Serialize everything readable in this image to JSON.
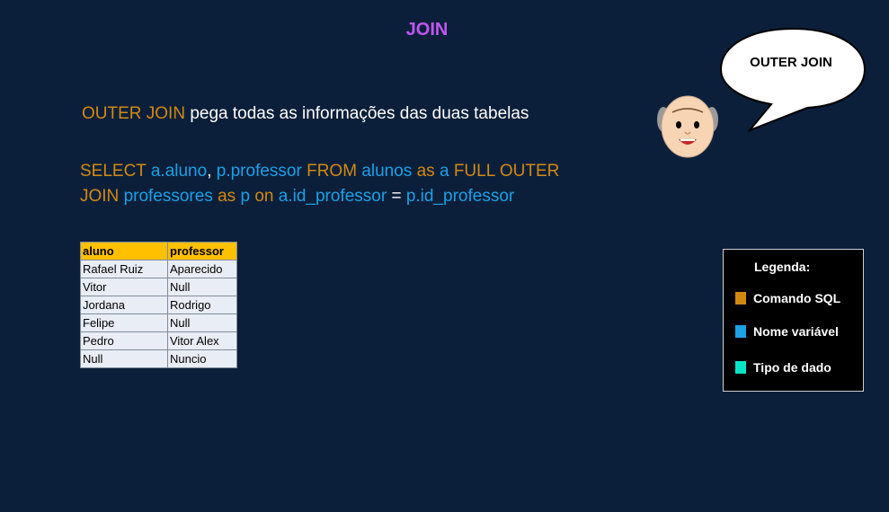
{
  "title": "JOIN",
  "description": {
    "keyword": "OUTER JOIN",
    "rest": " pega todas as informações das duas tabelas"
  },
  "sql": [
    {
      "text": "SELECT ",
      "type": "kw"
    },
    {
      "text": "a.aluno",
      "type": "var"
    },
    {
      "text": ", ",
      "type": "wh"
    },
    {
      "text": "p.professor ",
      "type": "var"
    },
    {
      "text": "FROM ",
      "type": "kw"
    },
    {
      "text": "alunos ",
      "type": "var"
    },
    {
      "text": "as ",
      "type": "kw"
    },
    {
      "text": "a ",
      "type": "var"
    },
    {
      "text": "FULL OUTER JOIN ",
      "type": "kw"
    },
    {
      "text": "professores ",
      "type": "var"
    },
    {
      "text": "as ",
      "type": "kw"
    },
    {
      "text": "p ",
      "type": "var"
    },
    {
      "text": "on ",
      "type": "kw"
    },
    {
      "text": "a.id_professor ",
      "type": "var"
    },
    {
      "text": "= ",
      "type": "wh"
    },
    {
      "text": "p.id_professor",
      "type": "var"
    }
  ],
  "table": {
    "headers": [
      "aluno",
      "professor"
    ],
    "rows": [
      [
        "Rafael Ruiz",
        "Aparecido"
      ],
      [
        "Vitor",
        "Null"
      ],
      [
        "Jordana",
        "Rodrigo"
      ],
      [
        "Felipe",
        "Null"
      ],
      [
        "Pedro",
        "Vitor Alex"
      ],
      [
        "Null",
        "Nuncio"
      ]
    ]
  },
  "speech_bubble": "OUTER JOIN",
  "legend": {
    "title": "Legenda:",
    "items": [
      {
        "label": "Comando SQL",
        "color": "#d08a12"
      },
      {
        "label": "Nome variável",
        "color": "#1da0e6"
      },
      {
        "label": "Tipo de dado",
        "color": "#00e5c8"
      }
    ]
  }
}
